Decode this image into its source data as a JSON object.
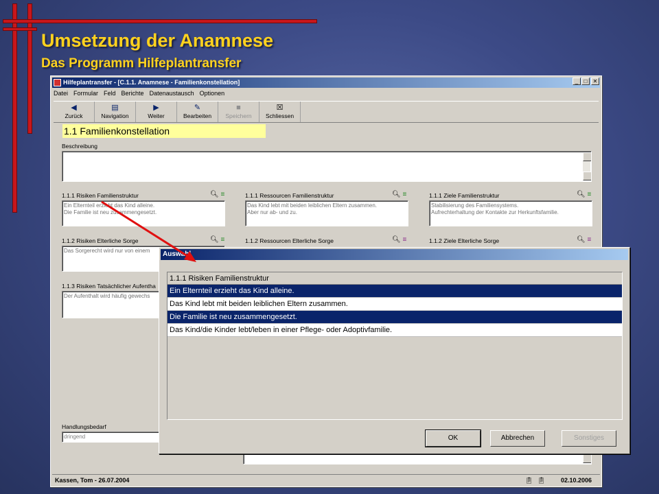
{
  "slide": {
    "title": "Umsetzung der Anamnese",
    "subtitle": "Das Programm Hilfeplantransfer"
  },
  "window": {
    "title": "Hilfeplantransfer - [C.1.1. Anamnese - Familienkonstellation]",
    "menu": [
      "Datei",
      "Formular",
      "Feld",
      "Berichte",
      "Datenaustausch",
      "Optionen"
    ],
    "toolbar": [
      {
        "label": "Zurück",
        "icon": "arrow-left-icon"
      },
      {
        "label": "Navigation",
        "icon": "navigation-icon"
      },
      {
        "label": "Weiter",
        "icon": "arrow-right-icon"
      },
      {
        "label": "Bearbeiten",
        "icon": "edit-icon"
      },
      {
        "label": "Speichern",
        "icon": "save-icon"
      },
      {
        "label": "Schliessen",
        "icon": "close-icon"
      }
    ],
    "section_title": "1.1 Familienkonstellation",
    "beschreibung_label": "Beschreibung",
    "fields": {
      "risiken_familie": {
        "label": "1.1.1 Risiken Familienstruktur",
        "text": "Ein Elternteil erzieht das Kind alleine.\nDie Familie ist neu zusammengesetzt."
      },
      "ressourcen_familie": {
        "label": "1.1.1 Ressourcen Familienstruktur",
        "text": "Das Kind lebt mit beiden leiblichen Eltern zusammen.\nAber nur ab- und zu."
      },
      "ziele_familie": {
        "label": "1.1.1 Ziele Familienstruktur",
        "text": "Stabilisierung des Familiensystems.\nAufrechterhaltung der Kontakte zur Herkunftsfamilie."
      },
      "risiken_sorge": {
        "label": "1.1.2 Risiken Elterliche Sorge",
        "text": "Das Sorgerecht wird nur von einem"
      },
      "ressourcen_sorge": {
        "label": "1.1.2 Ressourcen Elterliche Sorge"
      },
      "ziele_sorge": {
        "label": "1.1.2 Ziele Elterliche Sorge"
      },
      "risiken_aufenthalt": {
        "label": "1.1.3 Risiken Tatsächlicher Aufentha",
        "text": "Der Aufenthalt wird häufig gewechs"
      }
    },
    "handlungsbedarf": {
      "label": "Handlungsbedarf",
      "value": "dringend"
    },
    "status": {
      "user": "Kassen, Tom - 26.07.2004",
      "date": "02.10.2006"
    }
  },
  "dialog": {
    "title": "Auswahl",
    "header": "1.1.1 Risiken Familienstruktur",
    "items": [
      {
        "text": "Ein Elternteil erzieht das Kind alleine.",
        "selected": true
      },
      {
        "text": "Das Kind lebt mit beiden leiblichen Eltern zusammen.",
        "selected": false
      },
      {
        "text": "Die Familie ist neu zusammengesetzt.",
        "selected": true
      },
      {
        "text": "Das Kind/die Kinder lebt/leben in einer Pflege- oder Adoptivfamilie.",
        "selected": false
      }
    ],
    "buttons": {
      "ok": "OK",
      "cancel": "Abbrechen",
      "other": "Sonstiges"
    }
  },
  "colors": {
    "accent_red": "#c8161b",
    "title_yellow": "#ffd21e",
    "selection": "#0a246a",
    "section_bg": "#ffff9c"
  }
}
